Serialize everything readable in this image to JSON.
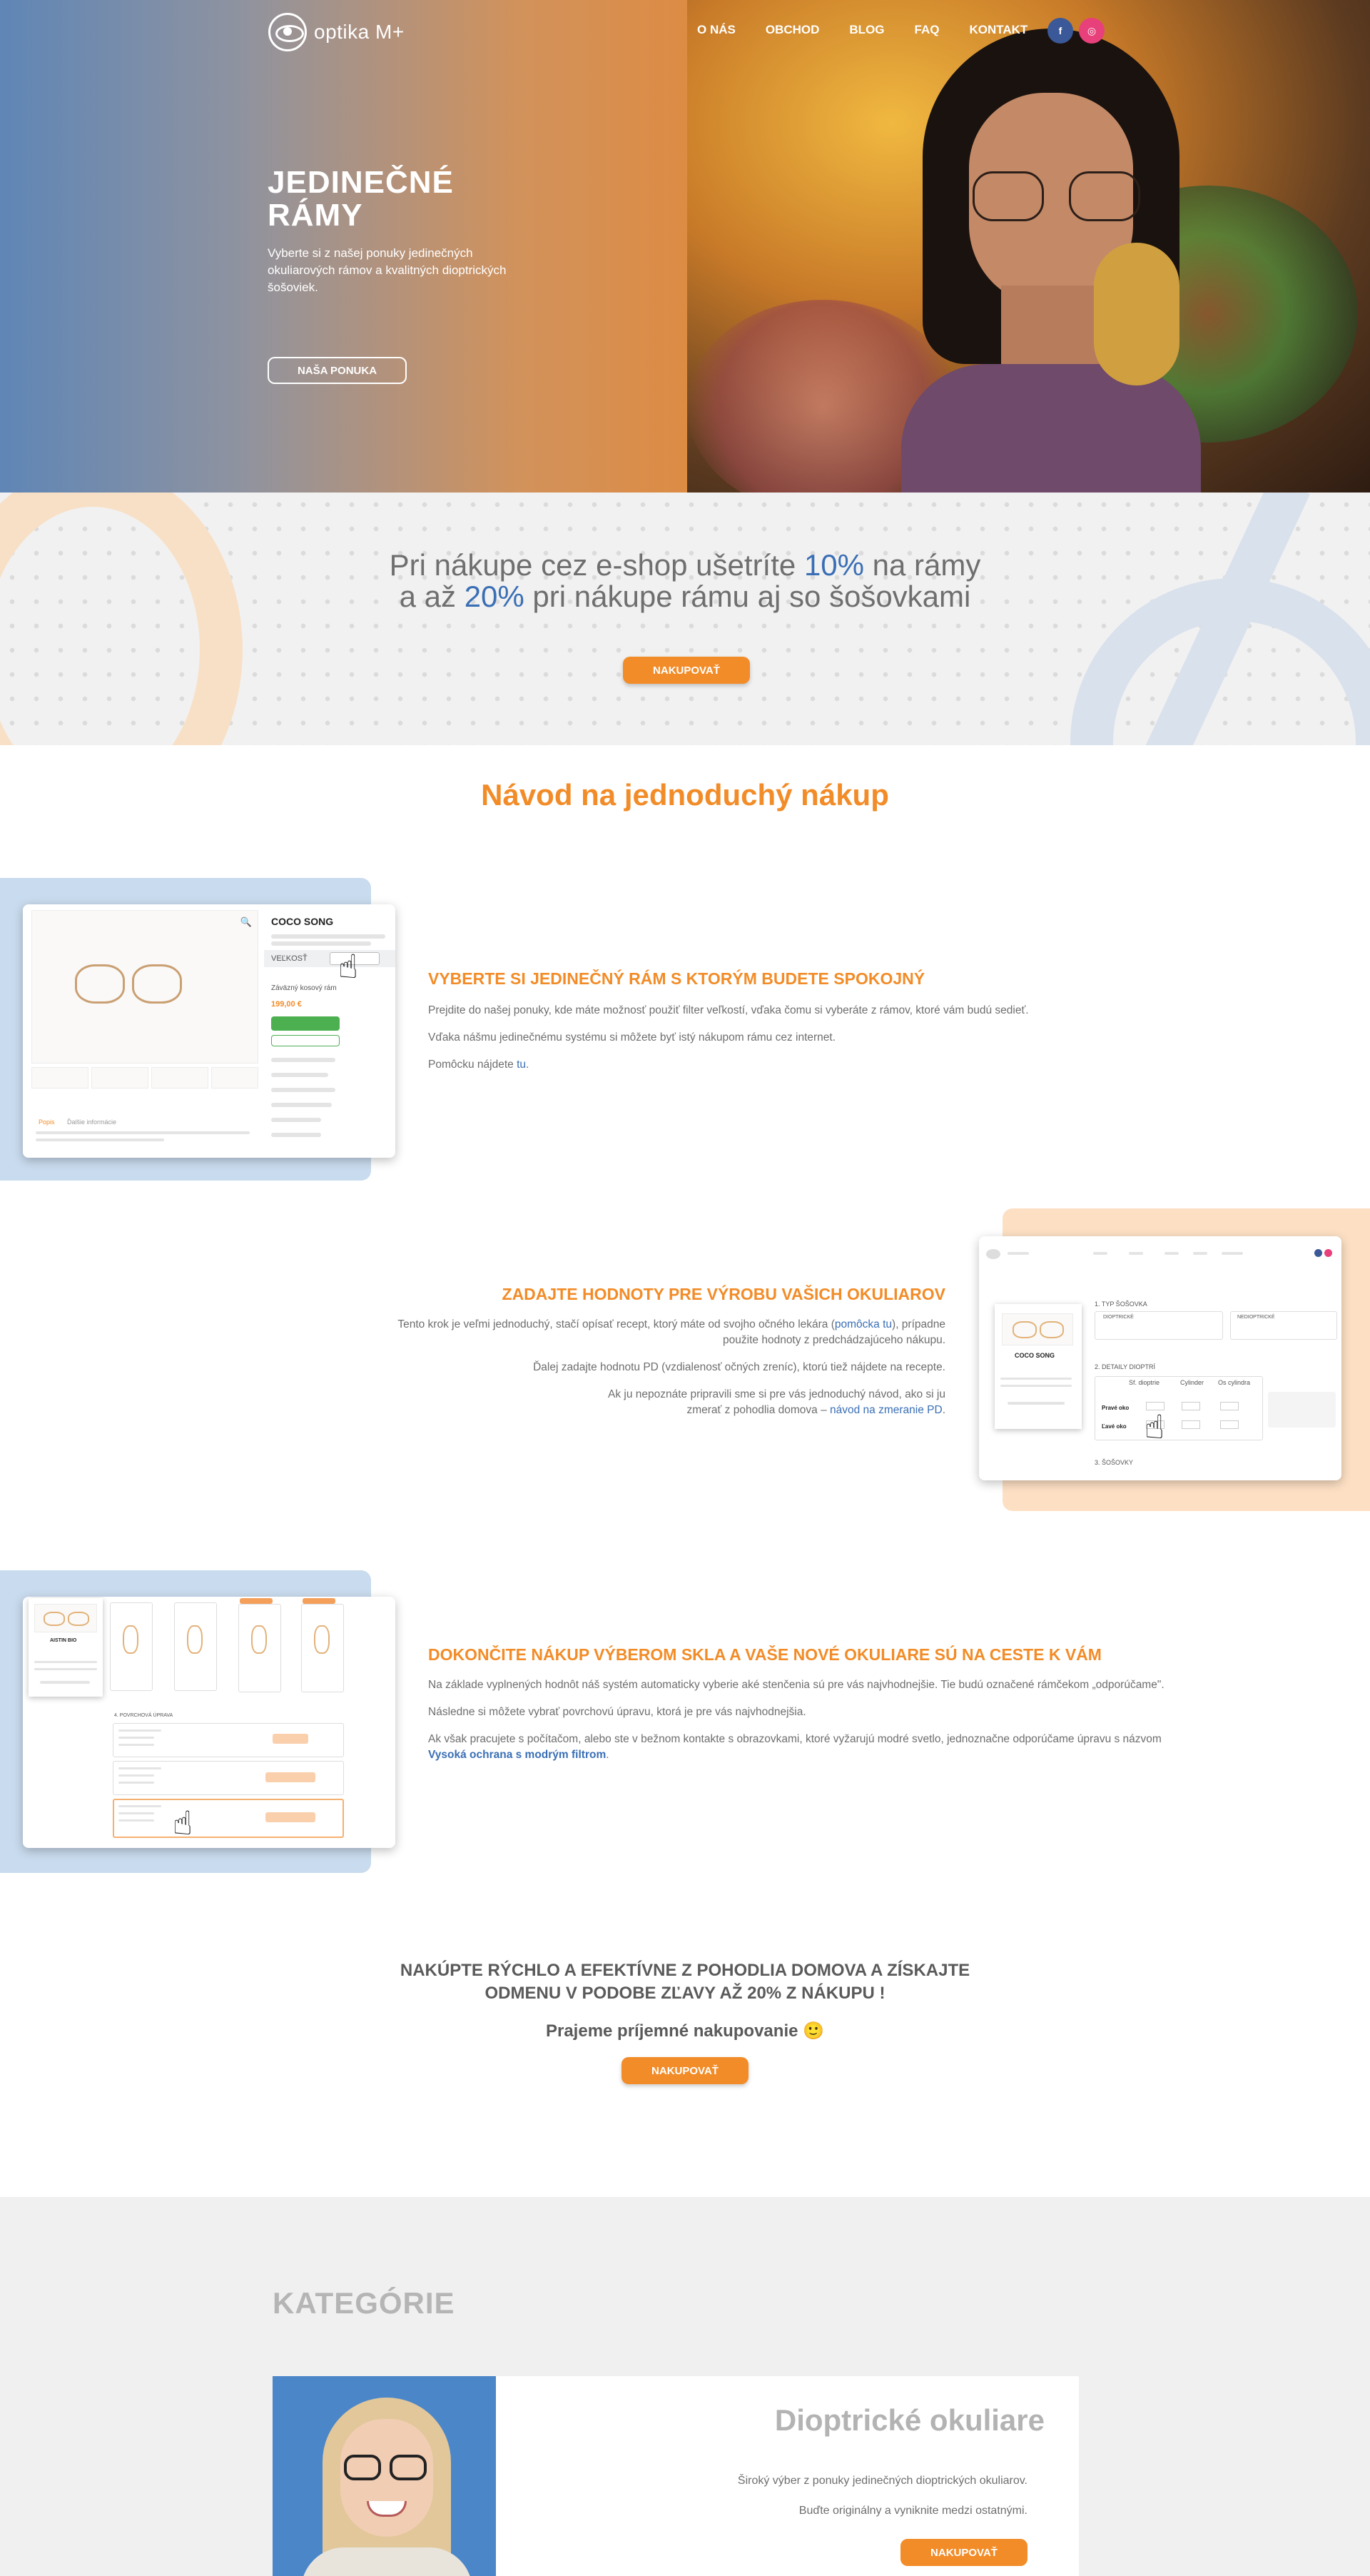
{
  "nav": {
    "logo_text": "optika M+",
    "items": [
      {
        "label": "O NÁS"
      },
      {
        "label": "OBCHOD"
      },
      {
        "label": "BLOG"
      },
      {
        "label": "FAQ"
      },
      {
        "label": "KONTAKT"
      }
    ],
    "social": [
      {
        "icon": "facebook-icon",
        "glyph": "f",
        "color": "#3b5998"
      },
      {
        "icon": "instagram-icon",
        "glyph": "◎",
        "color": "#e8407a"
      }
    ]
  },
  "hero": {
    "title_line1": "JEDINEČNÉ",
    "title_line2": "RÁMY",
    "subtitle": "Vyberte si z našej ponuky jedinečných okuliarových rámov a kvalitných dioptrických šošoviek.",
    "button": "NAŠA PONUKA"
  },
  "promo": {
    "line1_pre": "Pri nákupe cez e-shop ušetríte ",
    "line1_hl": "10%",
    "line1_post": " na rámy",
    "line2_pre": "a až ",
    "line2_hl": "20%",
    "line2_post": " pri nákupe rámu aj so šošovkami",
    "button": "NAKUPOVAŤ"
  },
  "guide": {
    "title": "Návod na jednoduchý nákup",
    "step1": {
      "heading": "VYBERTE SI JEDINEČNÝ RÁM S KTORÝM BUDETE SPOKOJNÝ",
      "p1": "Prejdite do našej ponuky, kde máte možnosť použiť filter veľkostí, vďaka čomu si vyberáte z rámov, ktoré vám budú sedieť.",
      "p2": "Vďaka nášmu jedinečnému systému si môžete byť istý nákupom rámu cez internet.",
      "p3_pre": "Pomôcku nájdete ",
      "p3_link": "tu",
      "p3_post": ".",
      "mock": {
        "product": "COCO SONG",
        "size": "VEĽKOSŤ",
        "order_label": "Záväzný kosový rám",
        "price": "199,00 €",
        "tab1": "Popis",
        "tab2": "Ďalšie informácie"
      }
    },
    "step2": {
      "heading": "ZADAJTE HODNOTY PRE VÝROBU VAŠICH OKULIAROV",
      "p1_pre": "Tento krok je veľmi jednoduchý, stačí opísať recept, ktorý máte od svojho očného lekára (",
      "p1_link": "pomôcka tu",
      "p1_post": "), prípadne použite hodnoty z predchádzajúceho nákupu.",
      "p2": "Ďalej zadajte hodnotu PD (vzdialenosť očných zreníc), ktorú tiež nájdete na recepte.",
      "p3_pre": "Ak ju nepoznáte pripravili sme si pre vás jednoduchý návod, ako si ju zmerať z pohodlia domova – ",
      "p3_link": "návod na zmeranie PD",
      "p3_post": ".",
      "mock": {
        "product": "COCO SONG",
        "sec1": "1. TYP ŠOŠOVKA",
        "sec2": "2. DETAILY DIOPTRÍ",
        "sec3": "3. ŠOŠOVKY",
        "col1": "Sf. dioptrie",
        "col2": "Cylinder",
        "col3": "Os cylindra",
        "row1": "Pravé oko",
        "row2": "Ľavé oko",
        "opt1": "DIOPTRICKÉ",
        "opt2": "NEDIOPTRICKÉ"
      }
    },
    "step3": {
      "heading": "DOKONČITE NÁKUP VÝBEROM SKLA A VAŠE NOVÉ OKULIARE SÚ NA CESTE K VÁM",
      "p1": "Na základe vyplnených hodnôt náš systém automaticky vyberie aké stenčenia sú pre vás najvhodnejšie. Tie budú označené rámčekom „odporúčame\".",
      "p2": "Následne si môžete vybrať povrchovú úpravu, ktorá je pre vás najvhodnejšia.",
      "p3_pre": "Ak však pracujete s počítačom, alebo ste v bežnom kontakte s obrazovkami, ktoré vyžarujú modré svetlo, jednoznačne odporúčame úpravu s názvom ",
      "p3_link": "Vysoká ochrana s modrým filtrom",
      "p3_post": ".",
      "mock": {
        "product": "AISTIN BIO",
        "sec4": "4. POVRCHOVÁ ÚPRAVA"
      }
    }
  },
  "cta": {
    "line1": "NAKÚPTE RÝCHLO A EFEKTÍVNE Z POHODLIA DOMOVA A ZÍSKAJTE",
    "line2": "ODMENU V PODOBE ZĽAVY AŽ 20% Z NÁKUPU !",
    "wish": "Prajeme príjemné nakupovanie 🙂",
    "button": "NAKUPOVAŤ"
  },
  "categories": {
    "title": "KATEGÓRIE",
    "card": {
      "name": "Dioptrické okuliare",
      "desc1": "Široký výber z ponuky jedinečných dioptrických okuliarov.",
      "desc2": "Buďte originálny a vyniknite medzi ostatnými.",
      "button": "NAKUPOVAŤ"
    }
  }
}
